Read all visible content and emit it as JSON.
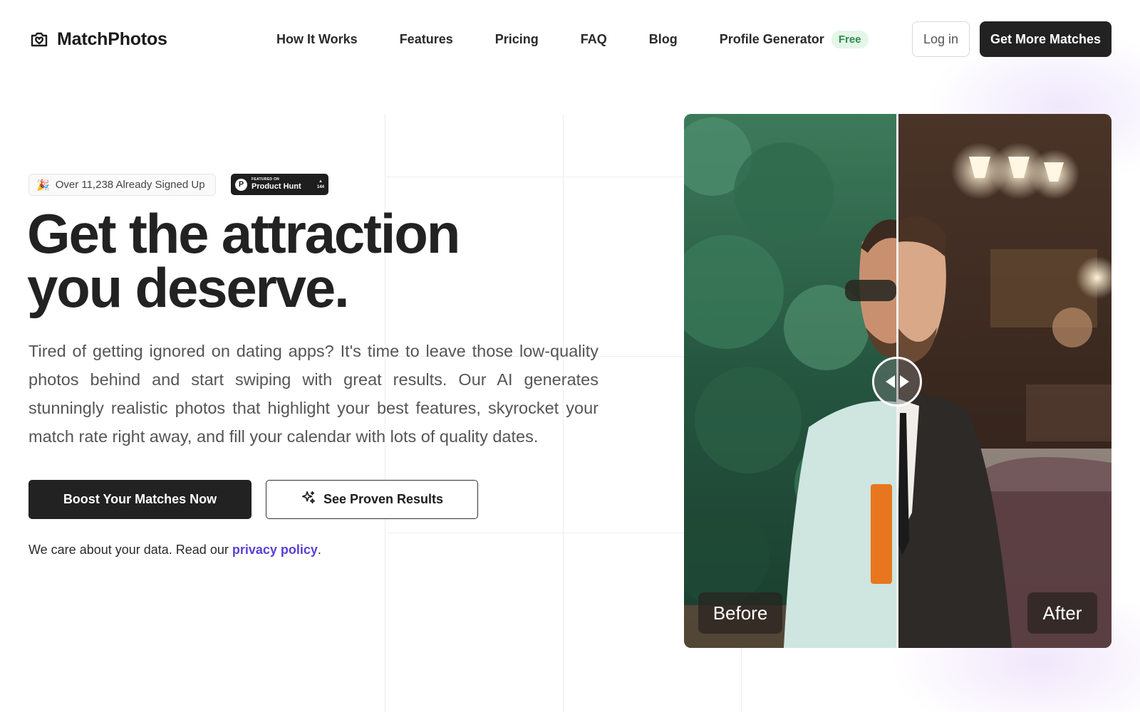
{
  "brand": {
    "name": "MatchPhotos",
    "icon": "camera-heart-icon"
  },
  "nav": {
    "links": [
      "How It Works",
      "Features",
      "Pricing",
      "FAQ",
      "Blog"
    ],
    "generator_label": "Profile Generator",
    "generator_badge": "Free",
    "login_label": "Log in",
    "cta_label": "Get More Matches"
  },
  "hero": {
    "signup_emoji": "🎉",
    "signup_text": "Over 11,238 Already Signed Up",
    "product_hunt": {
      "small": "FEATURED ON",
      "big": "Product Hunt",
      "votes": "144",
      "logo_letter": "P"
    },
    "title_line1": "Get the attraction",
    "title_line2": "you deserve.",
    "description": "Tired of getting ignored on dating apps? It's time to leave those low-quality photos behind and start swiping with great results. Our AI generates stunningly realistic photos that highlight your best features, skyrocket your match rate right away, and fill your calendar with lots of quality dates.",
    "primary_button": "Boost Your Matches Now",
    "secondary_button": "See Proven Results",
    "secondary_icon": "sparkles-icon",
    "privacy_prefix": "We care about your data. Read our ",
    "privacy_link": "privacy policy",
    "privacy_suffix": "."
  },
  "comparison": {
    "before_label": "Before",
    "after_label": "After",
    "handle_icon": "slider-arrows-icon",
    "slider_position": 0.5
  },
  "colors": {
    "primary": "#222222",
    "link": "#5a3fd6",
    "badge_free_bg": "#e4f6e8",
    "badge_free_text": "#2f8a4a"
  }
}
